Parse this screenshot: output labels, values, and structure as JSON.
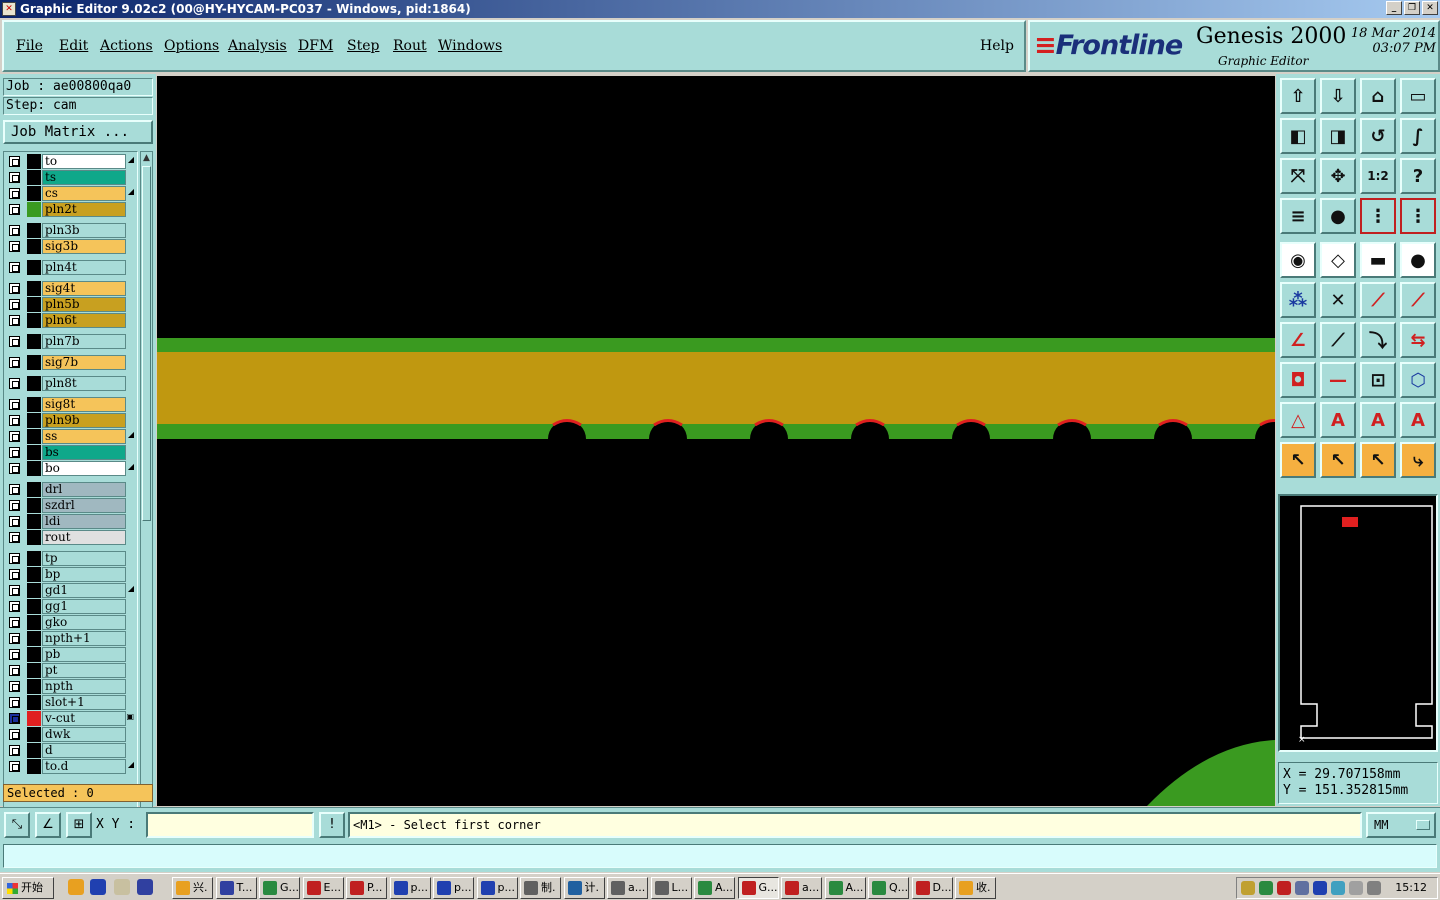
{
  "window": {
    "title": "Graphic Editor 9.02c2 (00@HY-HYCAM-PC037 - Windows, pid:1864)",
    "buttons": [
      "minimize",
      "restore",
      "close"
    ]
  },
  "menu": {
    "items": [
      "File",
      "Edit",
      "Actions",
      "Options",
      "Analysis",
      "DFM",
      "Step",
      "Rout",
      "Windows"
    ],
    "help": "Help"
  },
  "brand": {
    "logo": "Frontline",
    "product": "Genesis 2000",
    "subtitle": "Graphic Editor",
    "date": "18 Mar 2014",
    "time": "03:07 PM"
  },
  "job": {
    "job_label": "Job : ae00800qa0",
    "step_label": "Step: cam",
    "matrix_button": "Job Matrix ..."
  },
  "layers": [
    {
      "name": "to",
      "color": "#ffffff",
      "swatch": "#000000",
      "mark": "◢"
    },
    {
      "name": "ts",
      "color": "#0fa88a",
      "swatch": "#000000",
      "mark": ""
    },
    {
      "name": "cs",
      "color": "#f5c45a",
      "swatch": "#000000",
      "mark": "◢"
    },
    {
      "name": "pln2t",
      "color": "#c8a020",
      "swatch": "#3a9a20",
      "mark": ""
    },
    {
      "name": "pln3b",
      "color": "#a8dcd8",
      "swatch": "#000000",
      "mark": ""
    },
    {
      "name": "sig3b",
      "color": "#f5c45a",
      "swatch": "#000000",
      "mark": ""
    },
    {
      "name": "pln4t",
      "color": "#a8dcd8",
      "swatch": "#000000",
      "mark": ""
    },
    {
      "name": "sig4t",
      "color": "#f5c45a",
      "swatch": "#000000",
      "mark": ""
    },
    {
      "name": "pln5b",
      "color": "#c8a020",
      "swatch": "#000000",
      "mark": ""
    },
    {
      "name": "pln6t",
      "color": "#c8a020",
      "swatch": "#000000",
      "mark": ""
    },
    {
      "name": "pln7b",
      "color": "#a8dcd8",
      "swatch": "#000000",
      "mark": ""
    },
    {
      "name": "sig7b",
      "color": "#f5c45a",
      "swatch": "#000000",
      "mark": ""
    },
    {
      "name": "pln8t",
      "color": "#a8dcd8",
      "swatch": "#000000",
      "mark": ""
    },
    {
      "name": "sig8t",
      "color": "#f5c45a",
      "swatch": "#000000",
      "mark": ""
    },
    {
      "name": "pln9b",
      "color": "#c8a020",
      "swatch": "#000000",
      "mark": ""
    },
    {
      "name": "ss",
      "color": "#f5c45a",
      "swatch": "#000000",
      "mark": "◢"
    },
    {
      "name": "bs",
      "color": "#0fa88a",
      "swatch": "#000000",
      "mark": ""
    },
    {
      "name": "bo",
      "color": "#ffffff",
      "swatch": "#000000",
      "mark": "◢"
    },
    {
      "name": "drl",
      "color": "#a0b8c0",
      "swatch": "#000000",
      "mark": ""
    },
    {
      "name": "szdrl",
      "color": "#a0b8c0",
      "swatch": "#000000",
      "mark": ""
    },
    {
      "name": "ldi",
      "color": "#a0b8c0",
      "swatch": "#000000",
      "mark": ""
    },
    {
      "name": "rout",
      "color": "#e0e0e0",
      "swatch": "#000000",
      "mark": ""
    },
    {
      "name": "tp",
      "color": "#a8dcd8",
      "swatch": "#000000",
      "mark": ""
    },
    {
      "name": "bp",
      "color": "#a8dcd8",
      "swatch": "#000000",
      "mark": ""
    },
    {
      "name": "gd1",
      "color": "#a8dcd8",
      "swatch": "#000000",
      "mark": "◢"
    },
    {
      "name": "gg1",
      "color": "#a8dcd8",
      "swatch": "#000000",
      "mark": ""
    },
    {
      "name": "gko",
      "color": "#a8dcd8",
      "swatch": "#000000",
      "mark": ""
    },
    {
      "name": "npth+1",
      "color": "#a8dcd8",
      "swatch": "#000000",
      "mark": ""
    },
    {
      "name": "pb",
      "color": "#a8dcd8",
      "swatch": "#000000",
      "mark": ""
    },
    {
      "name": "pt",
      "color": "#a8dcd8",
      "swatch": "#000000",
      "mark": ""
    },
    {
      "name": "npth",
      "color": "#a8dcd8",
      "swatch": "#000000",
      "mark": ""
    },
    {
      "name": "slot+1",
      "color": "#a8dcd8",
      "swatch": "#000000",
      "mark": ""
    },
    {
      "name": "v-cut",
      "color": "#a8dcd8",
      "swatch": "#e02020",
      "mark": "▣",
      "active": true
    },
    {
      "name": "dwk",
      "color": "#a8dcd8",
      "swatch": "#000000",
      "mark": ""
    },
    {
      "name": "d",
      "color": "#a8dcd8",
      "swatch": "#000000",
      "mark": ""
    },
    {
      "name": "to.d",
      "color": "#a8dcd8",
      "swatch": "#000000",
      "mark": "◢"
    }
  ],
  "selected": "Selected : 0",
  "canvas": {
    "background": "#000000",
    "band_outer_color": "#3a9a20",
    "band_inner_color": "#c09810",
    "pad_highlight_color": "#e02020",
    "pad_count": 8
  },
  "toolbar": {
    "rows": [
      [
        "home-up-icon",
        "home-down-icon",
        "home-icon",
        "window-icon"
      ],
      [
        "pan-left-icon",
        "pan-right-icon",
        "rotate-icon",
        "snake-icon"
      ],
      [
        "zoom-fit-icon",
        "zoom-center-icon",
        "zoom-1to2-icon",
        "help-icon"
      ],
      [
        "layers-config-icon",
        "probe-icon",
        "net-icon",
        "net2-icon"
      ],
      [
        "pad-icon",
        "measure-icon",
        "ruler-icon",
        "dot-icon"
      ],
      [
        "nodes-icon",
        "cross-icon",
        "line-red-icon",
        "line-red2-icon"
      ],
      [
        "angle-icon",
        "slope-icon",
        "arc-icon",
        "mirror-icon"
      ],
      [
        "pad-red-icon",
        "dash-icon",
        "dim-icon",
        "shapes-icon"
      ],
      [
        "triangle-icon",
        "triangle-a-icon",
        "triangle-a2-icon",
        "triangle-a3-icon"
      ],
      [
        "select-arrow-icon",
        "select-box-icon",
        "select-poly-icon",
        "select-route-icon"
      ]
    ]
  },
  "coords": {
    "x": "X  =  29.707158mm",
    "y": "Y  =  151.352815mm"
  },
  "status": {
    "xy_label": "X Y :",
    "xy_value": "",
    "prompt": "<M1> - Select first corner",
    "units": "MM",
    "info_button": "!"
  },
  "taskbar": {
    "start": "开始",
    "buttons": [
      {
        "label": "兴.",
        "color": "#e8a020"
      },
      {
        "label": "T...",
        "color": "#3040a0"
      },
      {
        "label": "G...",
        "color": "#2a8a40"
      },
      {
        "label": "E...",
        "color": "#c02020"
      },
      {
        "label": "P...",
        "color": "#c02020"
      },
      {
        "label": "p...",
        "color": "#2040b0"
      },
      {
        "label": "p...",
        "color": "#2040b0"
      },
      {
        "label": "p...",
        "color": "#2040b0"
      },
      {
        "label": "制.",
        "color": "#606060"
      },
      {
        "label": "计.",
        "color": "#2060a0"
      },
      {
        "label": "a...",
        "color": "#606060"
      },
      {
        "label": "L...",
        "color": "#606060"
      },
      {
        "label": "A...",
        "color": "#2a8a40"
      },
      {
        "label": "G...",
        "color": "#c02020",
        "active": true
      },
      {
        "label": "a...",
        "color": "#c02020"
      },
      {
        "label": "A...",
        "color": "#2a8a40"
      },
      {
        "label": "Q...",
        "color": "#2a8a40"
      },
      {
        "label": "D...",
        "color": "#c02020"
      },
      {
        "label": "收.",
        "color": "#e8a020"
      }
    ],
    "clock": "15:12"
  }
}
